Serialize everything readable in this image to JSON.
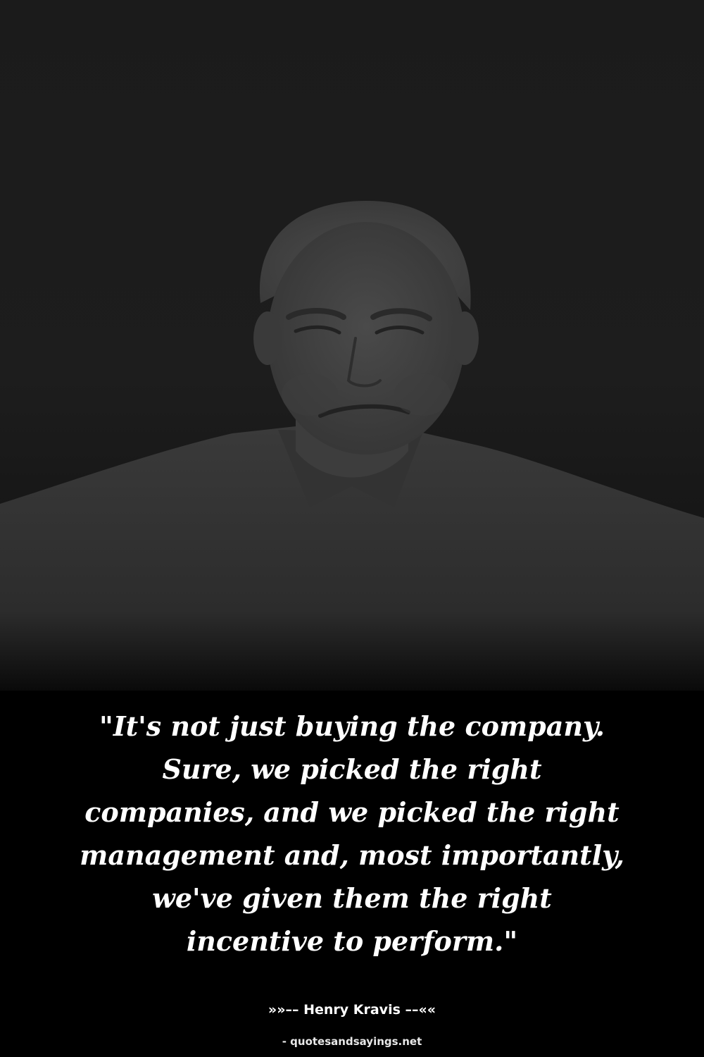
{
  "quote": {
    "lines": [
      "\"It's not just buying the company.",
      "Sure, we picked the right",
      "companies, and we picked the right",
      "management and, most importantly,",
      "we've given them the right",
      "incentive to perform.\""
    ]
  },
  "author": {
    "text": "»»–– Henry Kravis ––««"
  },
  "source": {
    "text": "- quotesandsayings.net"
  },
  "photo": {
    "subject": "portrait-photo"
  }
}
